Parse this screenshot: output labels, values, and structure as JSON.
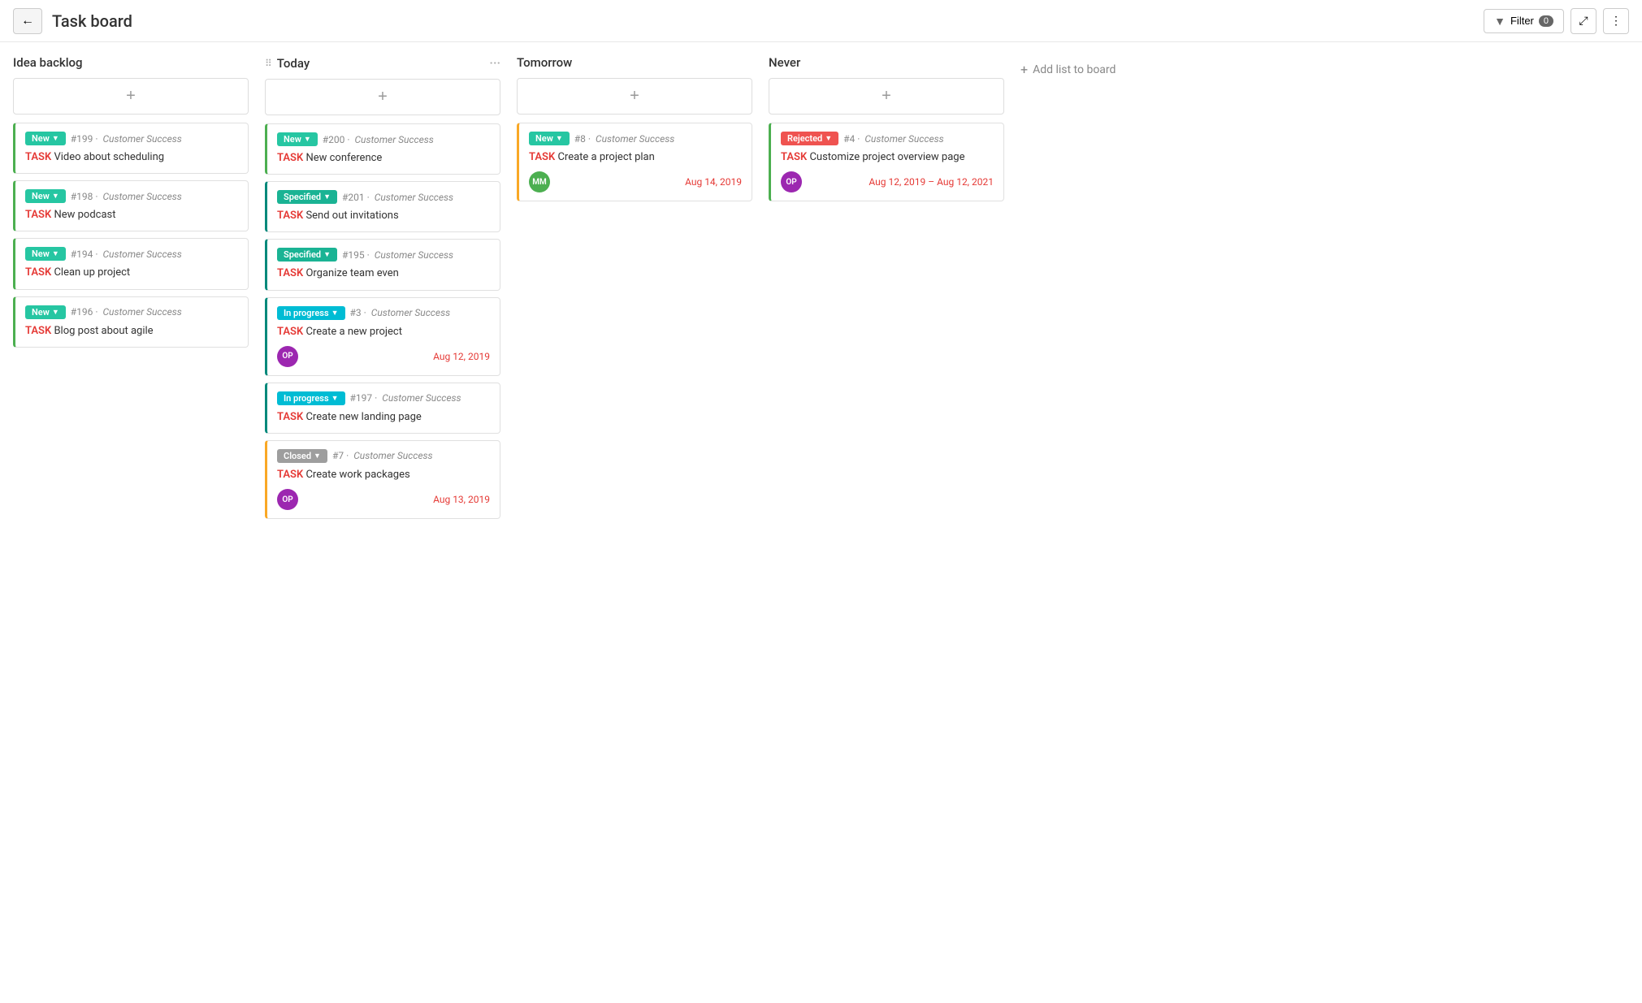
{
  "header": {
    "back_label": "←",
    "title": "Task board",
    "filter_label": "Filter",
    "filter_count": "0"
  },
  "board": {
    "add_list_label": "+ Add list to board",
    "columns": [
      {
        "id": "idea-backlog",
        "title": "Idea backlog",
        "has_drag": false,
        "has_more": false,
        "cards": [
          {
            "id": "c1",
            "border": "green",
            "status": "New",
            "status_class": "badge-new",
            "number": "#199",
            "project": "Customer Success",
            "title_label": "TASK",
            "title_text": " Video about scheduling",
            "avatar": null,
            "date": null
          },
          {
            "id": "c2",
            "border": "green",
            "status": "New",
            "status_class": "badge-new",
            "number": "#198",
            "project": "Customer Success",
            "title_label": "TASK",
            "title_text": " New podcast",
            "avatar": null,
            "date": null
          },
          {
            "id": "c3",
            "border": "green",
            "status": "New",
            "status_class": "badge-new",
            "number": "#194",
            "project": "Customer Success",
            "title_label": "TASK",
            "title_text": " Clean up project",
            "avatar": null,
            "date": null
          },
          {
            "id": "c4",
            "border": "green",
            "status": "New",
            "status_class": "badge-new",
            "number": "#196",
            "project": "Customer Success",
            "title_label": "TASK",
            "title_text": " Blog post about agile",
            "avatar": null,
            "date": null
          }
        ]
      },
      {
        "id": "today",
        "title": "Today",
        "has_drag": true,
        "has_more": true,
        "cards": [
          {
            "id": "t1",
            "border": "green",
            "status": "New",
            "status_class": "badge-new",
            "number": "#200",
            "project": "Customer Success",
            "title_label": "TASK",
            "title_text": " New conference",
            "avatar": null,
            "date": null
          },
          {
            "id": "t2",
            "border": "teal",
            "status": "Specified",
            "status_class": "badge-specified",
            "number": "#201",
            "project": "Customer Success",
            "title_label": "TASK",
            "title_text": " Send out invitations",
            "avatar": null,
            "date": null
          },
          {
            "id": "t3",
            "border": "teal",
            "status": "Specified",
            "status_class": "badge-specified",
            "number": "#195",
            "project": "Customer Success",
            "title_label": "TASK",
            "title_text": " Organize team even",
            "avatar": null,
            "date": null
          },
          {
            "id": "t4",
            "border": "teal",
            "status": "In progress",
            "status_class": "badge-inprogress",
            "number": "#3",
            "project": "Customer Success",
            "title_label": "TASK",
            "title_text": " Create a new project",
            "avatar": "OP",
            "avatar_class": "avatar-op",
            "date": "Aug 12, 2019"
          },
          {
            "id": "t5",
            "border": "teal",
            "status": "In progress",
            "status_class": "badge-inprogress",
            "number": "#197",
            "project": "Customer Success",
            "title_label": "TASK",
            "title_text": " Create new landing page",
            "avatar": null,
            "date": null
          },
          {
            "id": "t6",
            "border": "yellow",
            "status": "Closed",
            "status_class": "badge-closed",
            "number": "#7",
            "project": "Customer Success",
            "title_label": "TASK",
            "title_text": " Create work packages",
            "avatar": "OP",
            "avatar_class": "avatar-op",
            "date": "Aug 13, 2019"
          }
        ]
      },
      {
        "id": "tomorrow",
        "title": "Tomorrow",
        "has_drag": false,
        "has_more": false,
        "cards": [
          {
            "id": "tm1",
            "border": "yellow",
            "status": "New",
            "status_class": "badge-new",
            "number": "#8",
            "project": "Customer Success",
            "title_label": "TASK",
            "title_text": " Create a project plan",
            "avatar": "MM",
            "avatar_class": "avatar-mm",
            "date": "Aug 14, 2019"
          }
        ]
      },
      {
        "id": "never",
        "title": "Never",
        "has_drag": false,
        "has_more": false,
        "cards": [
          {
            "id": "n1",
            "border": "green",
            "status": "Rejected",
            "status_class": "badge-rejected",
            "number": "#4",
            "project": "Customer Success",
            "title_label": "TASK",
            "title_text": " Customize project overview page",
            "avatar": "OP",
            "avatar_class": "avatar-op",
            "date": "Aug 12, 2019 – Aug 12, 2021"
          }
        ]
      }
    ]
  }
}
